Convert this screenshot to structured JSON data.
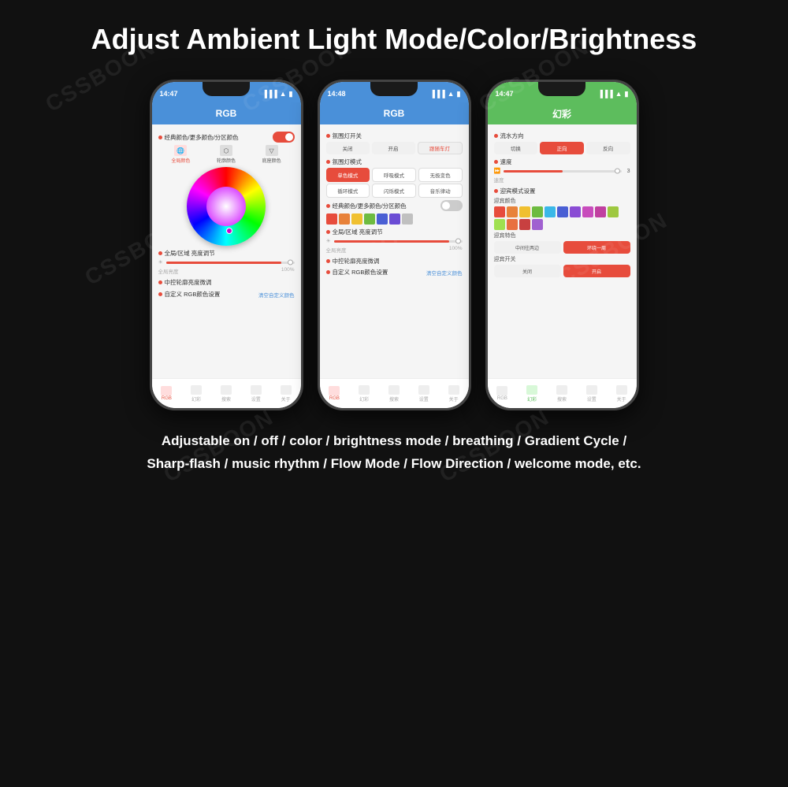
{
  "page": {
    "title": "Adjust Ambient Light Mode/Color/Brightness",
    "background": "#111111"
  },
  "watermarks": [
    "CSSBOON",
    "CSSBOON",
    "CSSBOON",
    "CSSBOON",
    "CSSBOON",
    "CSSBOON"
  ],
  "description_line1": "Adjustable on / off / color / brightness mode / breathing / Gradient Cycle /",
  "description_line2": "Sharp-flash / music rhythm / Flow Mode / Flow Direction / welcome mode, etc.",
  "phone1": {
    "time": "14:47",
    "header": "RGB",
    "section1": "经典颜色/更多颜色/分区颜色",
    "icon_labels": [
      "全局颜色",
      "轮廓颜色",
      "底座颜色"
    ],
    "brightness_label": "全局/区域 亮度调节",
    "brightness_val": "100%",
    "brightness_sublabel": "全局亮度",
    "fine_label": "中控轮廓亮度微调",
    "custom_label": "自定义 RGB颜色设置",
    "custom_link": "清空自定义颜色",
    "tabs": [
      "RGB",
      "幻彩",
      "搜索",
      "设置",
      "关于"
    ]
  },
  "phone2": {
    "time": "14:48",
    "header": "RGB",
    "switch_label": "氛围灯开关",
    "switch_options": [
      "关闭",
      "开启",
      "跟随车灯"
    ],
    "mode_label": "氛围灯模式",
    "modes_row1": [
      "单色模式",
      "呼吸模式",
      "无极变色"
    ],
    "modes_row2": [
      "循环模式",
      "闪烁模式",
      "音乐律动"
    ],
    "color_label": "经典颜色/更多颜色/分区颜色",
    "brightness_label": "全局/区域 亮度调节",
    "brightness_val": "100%",
    "brightness_sublabel": "全局亮度",
    "fine_label": "中控轮廓亮度微调",
    "custom_label": "自定义 RGB颜色设置",
    "custom_link": "清空自定义颜色",
    "tabs": [
      "RGB",
      "幻彩",
      "搜索",
      "设置",
      "关于"
    ]
  },
  "phone3": {
    "time": "14:47",
    "header": "幻彩",
    "header_color": "green",
    "direction_label": "流水方向",
    "direction_options": [
      "切换",
      "正向",
      "反向"
    ],
    "speed_label": "速度",
    "speed_value": "3",
    "welcome_setup_label": "迎宾模式设置",
    "welcome_color_label": "迎宾颜色",
    "welcome_special_label": "迎宾特色",
    "welcome_special_options": [
      "中间往两边",
      "环绕一周"
    ],
    "welcome_switch_label": "迎宾开关",
    "welcome_switch_options": [
      "关闭",
      "开启"
    ],
    "tabs": [
      "RGB",
      "幻彩",
      "搜索",
      "设置",
      "关于"
    ],
    "colors": [
      "#e74c3c",
      "#e8823a",
      "#f0c030",
      "#6dbb40",
      "#3ab8e8",
      "#4a5fd4",
      "#8a4cd4",
      "#c84cbc",
      "#c040a0",
      "#9ec840",
      "#a0e050",
      "#e87040",
      "#c84040",
      "#a060d0"
    ],
    "active_tab": 1
  }
}
